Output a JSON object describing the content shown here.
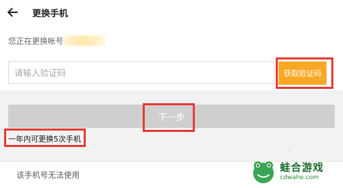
{
  "header": {
    "title": "更换手机",
    "back_icon": "arrow-left-icon"
  },
  "account": {
    "label": "您正在更换帐号"
  },
  "verification": {
    "placeholder": "请输入验证码",
    "get_code_label": "获取验证码"
  },
  "next_button_label": "下一步",
  "limit_text": "一年内可更换5次手机",
  "bottom_link": "该手机号无法使用",
  "watermark": {
    "title": "蛙合游戏",
    "domain": "cdwahe.com"
  },
  "colors": {
    "accent": "#f9a825",
    "highlight": "#e53935",
    "disabled_button": "#cfcfcf",
    "background": "#f2f2f2"
  }
}
